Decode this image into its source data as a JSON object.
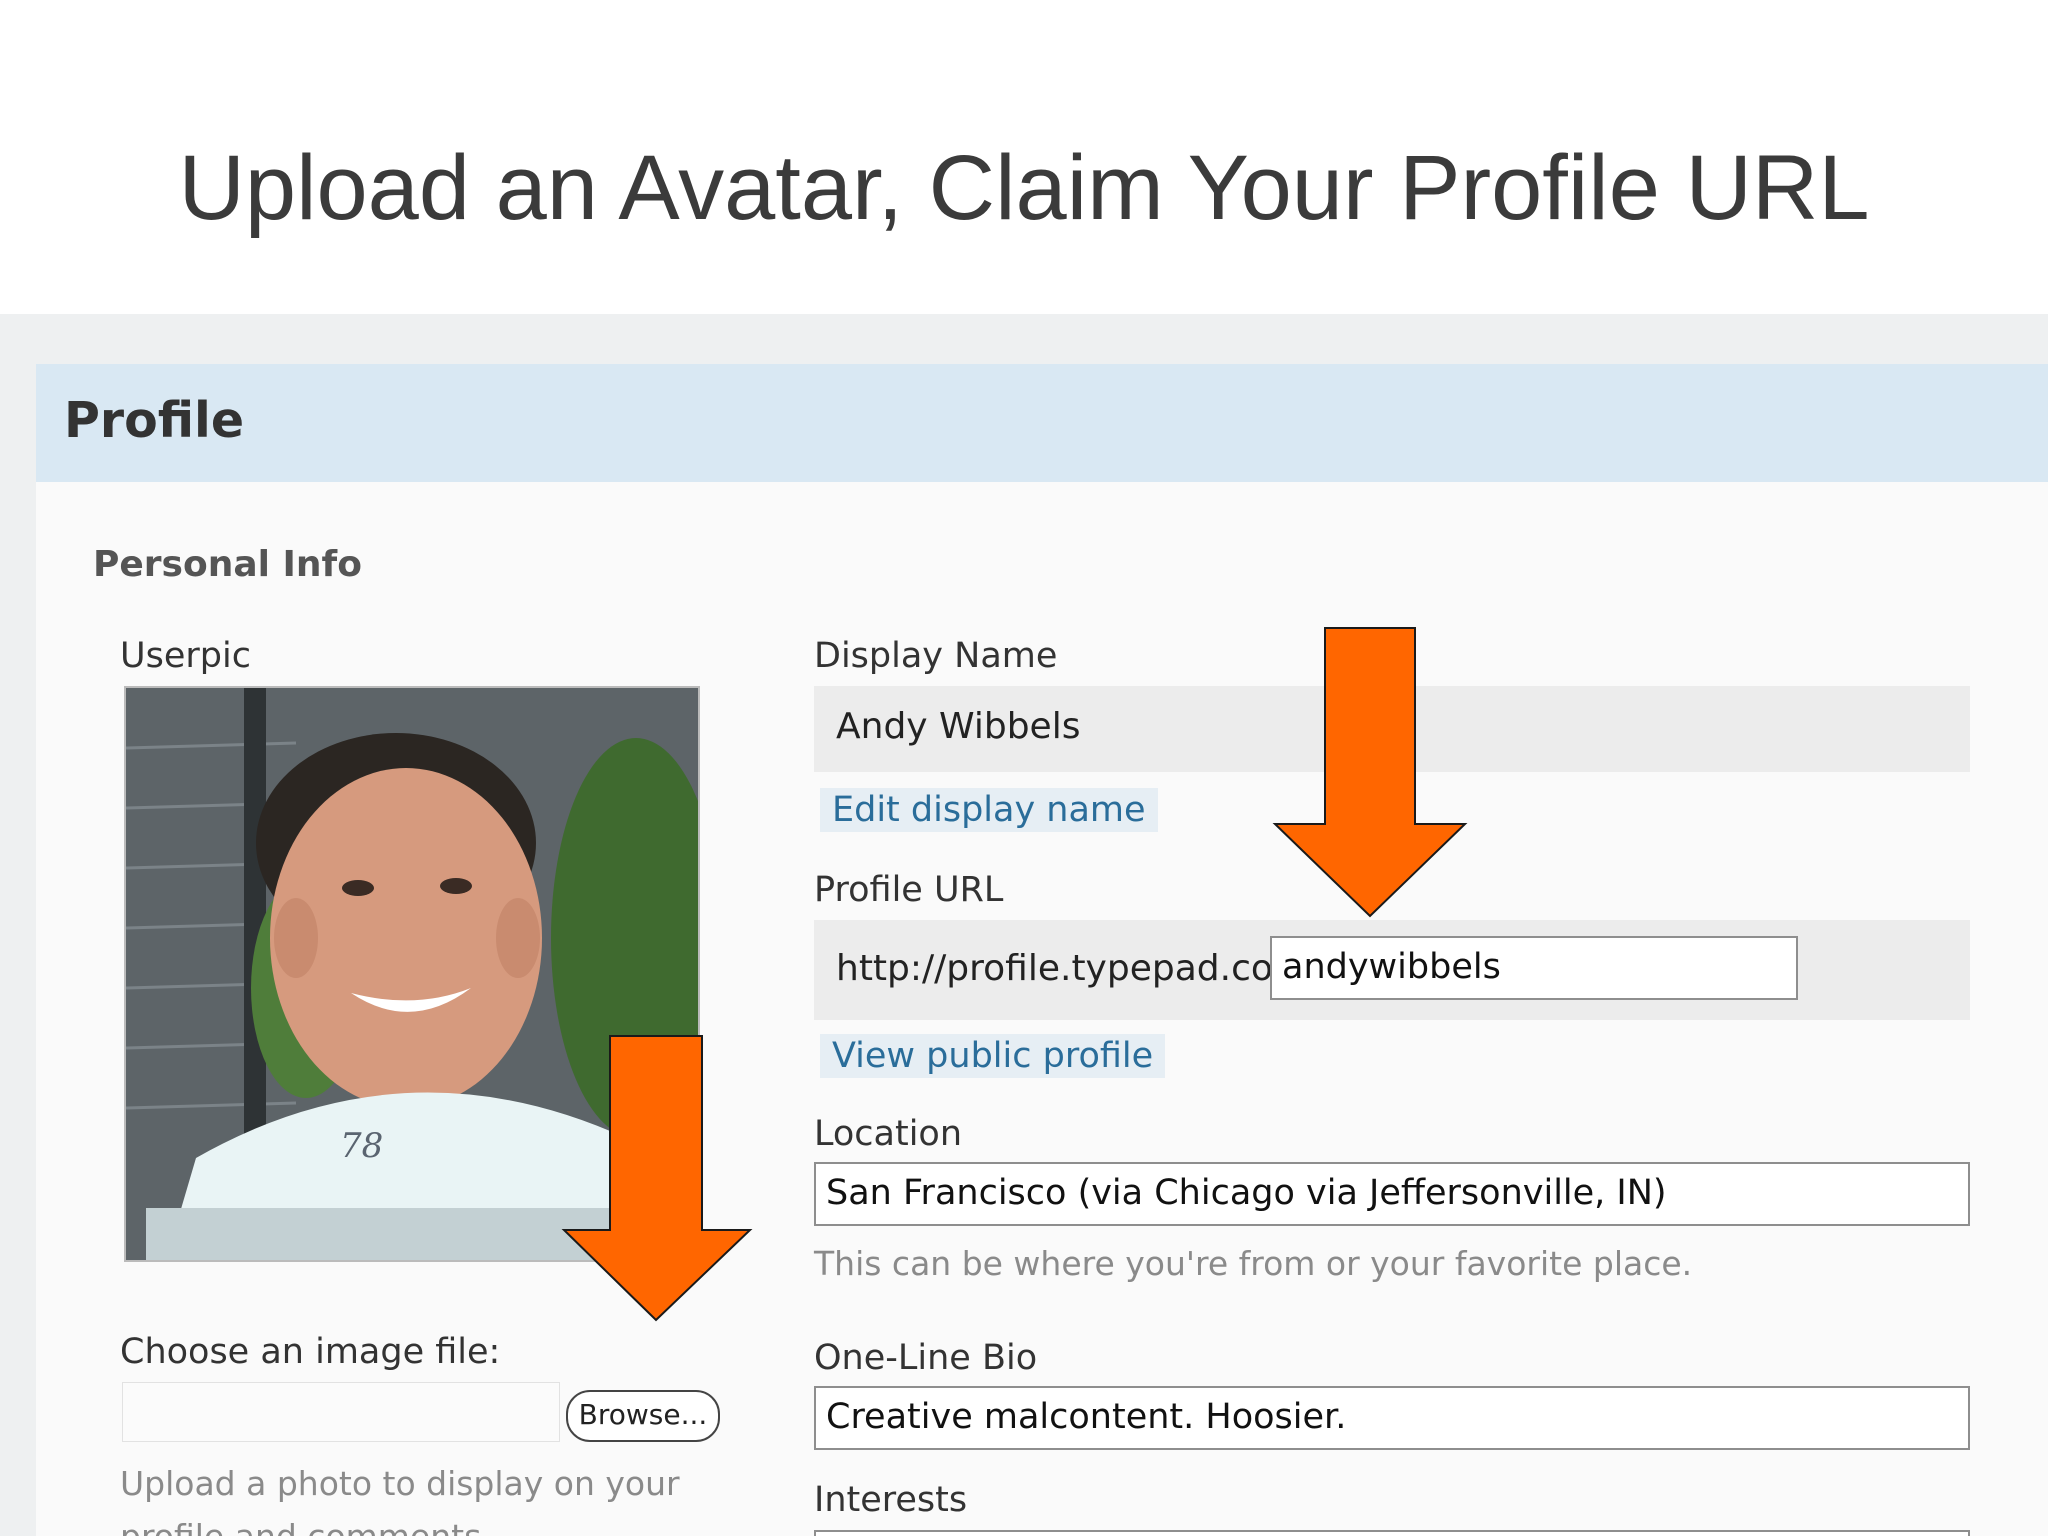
{
  "slide": {
    "title": "Upload an Avatar, Claim Your Profile URL"
  },
  "panel": {
    "title": "Profile",
    "section": "Personal Info"
  },
  "userpic": {
    "label": "Userpic",
    "shirt_text": "78",
    "choose_label": "Choose an image file:",
    "browse_label": "Browse...",
    "help_line1": "Upload a photo to display on your",
    "help_line2": "profile and comments."
  },
  "display_name": {
    "label": "Display Name",
    "value": "Andy Wibbels",
    "edit_link": "Edit display name"
  },
  "profile_url": {
    "label": "Profile URL",
    "prefix": "http://profile.typepad.com/",
    "value": "andywibbels",
    "view_link": "View public profile"
  },
  "location": {
    "label": "Location",
    "value": "San Francisco (via Chicago via Jeffersonville, IN)",
    "help": "This can be where you're from or your favorite place."
  },
  "bio": {
    "label": "One-Line Bio",
    "value": "Creative malcontent. Hoosier."
  },
  "interests": {
    "label": "Interests"
  },
  "colors": {
    "arrow": "#ff6600",
    "header_bg": "#d9e8f3",
    "link": "#2a6d9a"
  }
}
